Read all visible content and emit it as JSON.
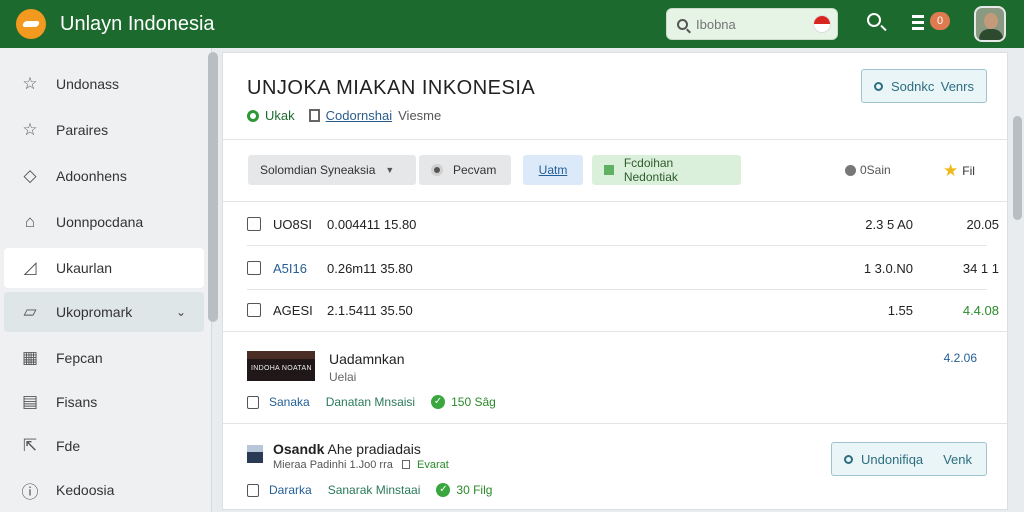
{
  "app": {
    "title": "Unlayn Indonesia"
  },
  "search": {
    "placeholder": "Ibobna"
  },
  "header": {
    "notifications": "0"
  },
  "sidebar": {
    "items": [
      {
        "label": "Undonass",
        "icon": "star-outline-icon"
      },
      {
        "label": "Paraires",
        "icon": "star-outline-icon"
      },
      {
        "label": "Adoonhens",
        "icon": "tag-icon"
      },
      {
        "label": "Uonnpocdana",
        "icon": "home-icon"
      },
      {
        "label": "Ukaurlan",
        "icon": "chart-icon"
      },
      {
        "label": "Ukopromark",
        "icon": "folder-icon"
      },
      {
        "label": "Fepcan",
        "icon": "calendar-icon"
      },
      {
        "label": "Fisans",
        "icon": "document-icon"
      },
      {
        "label": "Fde",
        "icon": "export-icon"
      },
      {
        "label": "Kedoosia",
        "icon": "info-icon"
      }
    ]
  },
  "main": {
    "title": "UNJOKA MIAKAN INKONESIA",
    "meta": {
      "status": "Ukak",
      "link": "Codornshai",
      "extra": "Viesme"
    },
    "top_button": {
      "label": "Sodnkc",
      "right": "Venrs"
    },
    "filters": {
      "dropdown": "Solomdian Syneaksia",
      "program": "Pecvam",
      "active": "Uatm",
      "green": "Fcdoihan Nedontiak",
      "sort1": "0Sain",
      "sort2": "Fil"
    },
    "rows": [
      {
        "code": "UO8SI",
        "date": "0.004411 15.80",
        "v1": "2.3 5 A0",
        "v2": "20.05"
      },
      {
        "code": "A5I16",
        "date": "0.26m11 35.80",
        "v1": "1 3.0.N0",
        "v2": "34 1 1"
      },
      {
        "code": "AGESI",
        "date": "2.1.5411 35.50",
        "v1": "1.55",
        "v2": "4.4.08"
      }
    ],
    "entry": {
      "thumb_text": "INDOHA NOATAN",
      "name": "Uadamnkan",
      "sub": "Uelai",
      "value": "4.2.06",
      "tag1": "Sanaka",
      "tag2": "Danatan Mnsaisi",
      "tag3": "150 Sâg"
    },
    "entry2": {
      "name": "Osandk",
      "name2": "Ahe pradiadais",
      "sub1": "Mieraa",
      "sub2": "Padinhi 1.Jo0 rra",
      "sub3": "Evarat",
      "button": "Undonifiqa",
      "button_right": "Venk",
      "tag1": "Dararka",
      "tag2": "Sanarak Minstaai",
      "tag3": "30 Filg"
    }
  }
}
